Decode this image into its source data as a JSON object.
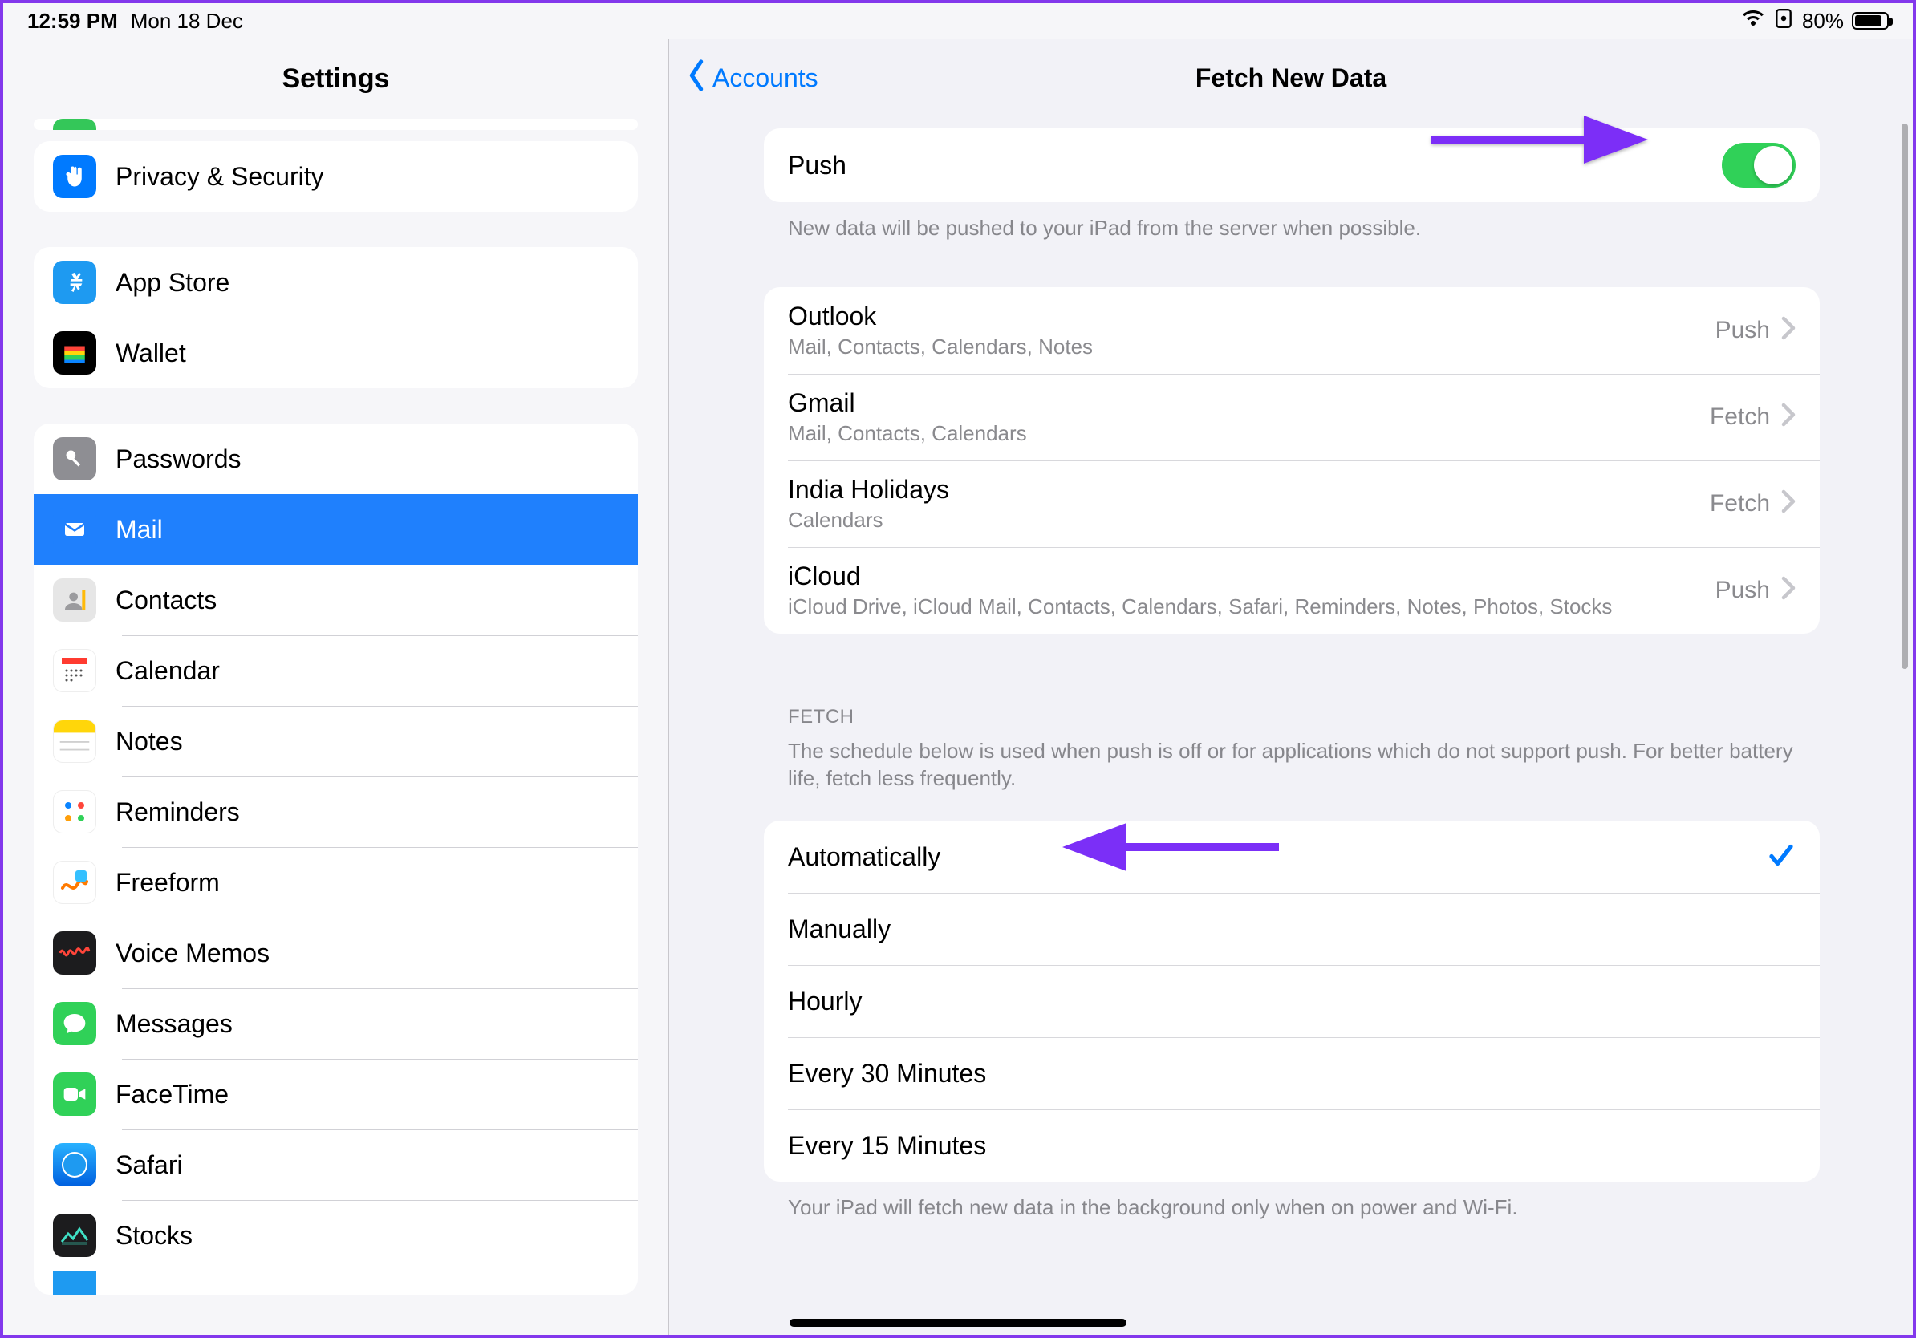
{
  "status": {
    "time": "12:59 PM",
    "date": "Mon 18 Dec",
    "battery_pct": "80%"
  },
  "sidebar": {
    "title": "Settings",
    "group1": [
      {
        "label": "Privacy & Security"
      }
    ],
    "group2": [
      {
        "label": "App Store"
      },
      {
        "label": "Wallet"
      }
    ],
    "group3": [
      {
        "label": "Passwords"
      },
      {
        "label": "Mail"
      },
      {
        "label": "Contacts"
      },
      {
        "label": "Calendar"
      },
      {
        "label": "Notes"
      },
      {
        "label": "Reminders"
      },
      {
        "label": "Freeform"
      },
      {
        "label": "Voice Memos"
      },
      {
        "label": "Messages"
      },
      {
        "label": "FaceTime"
      },
      {
        "label": "Safari"
      },
      {
        "label": "Stocks"
      }
    ]
  },
  "main": {
    "back_label": "Accounts",
    "title": "Fetch New Data",
    "push": {
      "label": "Push",
      "footer": "New data will be pushed to your iPad from the server when possible."
    },
    "accounts": [
      {
        "name": "Outlook",
        "detail": "Mail, Contacts, Calendars, Notes",
        "mode": "Push"
      },
      {
        "name": "Gmail",
        "detail": "Mail, Contacts, Calendars",
        "mode": "Fetch"
      },
      {
        "name": "India Holidays",
        "detail": "Calendars",
        "mode": "Fetch"
      },
      {
        "name": "iCloud",
        "detail": "iCloud Drive, iCloud Mail, Contacts, Calendars, Safari, Reminders, Notes, Photos, Stocks",
        "mode": "Push"
      }
    ],
    "fetch": {
      "header": "FETCH",
      "desc": "The schedule below is used when push is off or for applications which do not support push. For better battery life, fetch less frequently.",
      "options": [
        "Automatically",
        "Manually",
        "Hourly",
        "Every 30 Minutes",
        "Every 15 Minutes"
      ],
      "selected": "Automatically",
      "footer": "Your iPad will fetch new data in the background only when on power and Wi-Fi."
    }
  }
}
